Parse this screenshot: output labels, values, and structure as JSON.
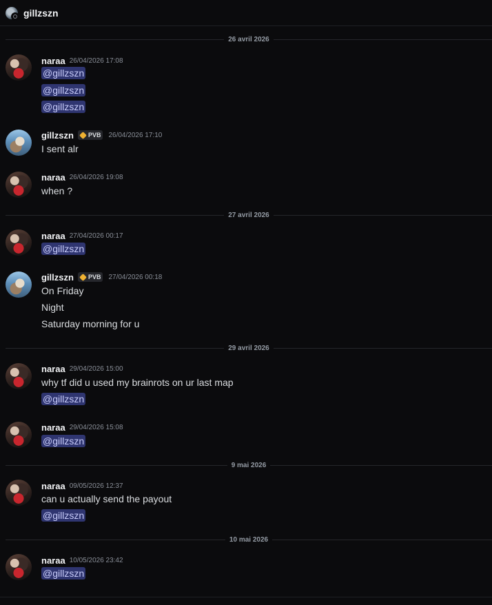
{
  "header": {
    "title": "gillzszn",
    "avatar_icon": "user-avatar-icon",
    "status_icon": "offline-status-icon"
  },
  "dividers": {
    "d1": "26 avril 2026",
    "d2": "27 avril 2026",
    "d3": "29 avril 2026",
    "d4": "9 mai 2026",
    "d5": "10 mai 2026"
  },
  "tag": {
    "label": "PVB",
    "icon": "guild-tag-icon",
    "color": "#f0b232"
  },
  "messages": [
    {
      "author": "naraa",
      "time": "26/04/2026 17:08",
      "lines": [
        "@gillzszn",
        "@gillzszn",
        "@gillzszn"
      ]
    },
    {
      "author": "gillzszn",
      "time": "26/04/2026 17:10",
      "lines": [
        "I sent alr"
      ]
    },
    {
      "author": "naraa",
      "time": "26/04/2026 19:08",
      "lines": [
        "when ?"
      ]
    },
    {
      "author": "naraa",
      "time": "27/04/2026 00:17",
      "lines": [
        "@gillzszn"
      ]
    },
    {
      "author": "gillzszn",
      "time": "27/04/2026 00:18",
      "lines": [
        "On Friday",
        "Night",
        "Saturday morning for u"
      ]
    },
    {
      "author": "naraa",
      "time": "29/04/2026 15:00",
      "lines": [
        "why tf did u used my brainrots on ur last map",
        "@gillzszn"
      ]
    },
    {
      "author": "naraa",
      "time": "29/04/2026 15:08",
      "lines": [
        "@gillzszn"
      ]
    },
    {
      "author": "naraa",
      "time": "09/05/2026 12:37",
      "lines": [
        "can u actually send the payout",
        "@gillzszn"
      ]
    },
    {
      "author": "naraa",
      "time": "10/05/2026 23:42",
      "lines": [
        "@gillzszn"
      ]
    }
  ],
  "colors": {
    "background": "#0b0b0d",
    "mention_bg": "#2f3570",
    "mention_text": "#c9cdfb"
  }
}
